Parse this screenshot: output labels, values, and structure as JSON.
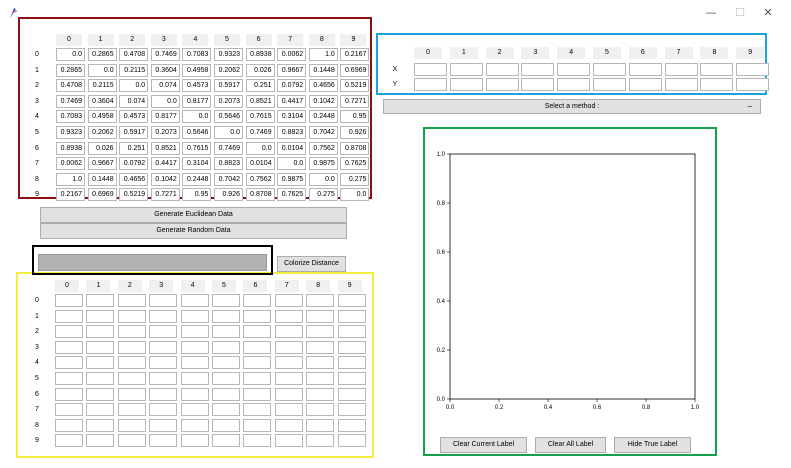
{
  "window": {
    "minimize_glyph": "—",
    "maximize_glyph": "☐",
    "close_glyph": "✕",
    "icon": "feather-icon"
  },
  "colors": {
    "distance_frame": "#8b0f0f",
    "coordinate_frame": "#19a4dc",
    "progress_frame": "#000000",
    "label_frame": "#f0ee3c",
    "plot_frame": "#13a14a",
    "progress_fill": "#b2b2b2"
  },
  "distance_matrix": {
    "columns": [
      "0",
      "1",
      "2",
      "3",
      "4",
      "5",
      "6",
      "7",
      "8",
      "9"
    ],
    "rows": [
      {
        "label": "0",
        "values": [
          "0.0",
          "0.2865",
          "0.4708",
          "0.7469",
          "0.7083",
          "0.9323",
          "0.8938",
          "0.0062",
          "1.0",
          "0.2167"
        ]
      },
      {
        "label": "1",
        "values": [
          "0.2865",
          "0.0",
          "0.2115",
          "0.3604",
          "0.4958",
          "0.2062",
          "0.026",
          "0.9667",
          "0.1448",
          "0.6969"
        ]
      },
      {
        "label": "2",
        "values": [
          "0.4708",
          "0.2115",
          "0.0",
          "0.074",
          "0.4573",
          "0.5917",
          "0.251",
          "0.0792",
          "0.4656",
          "0.5219"
        ]
      },
      {
        "label": "3",
        "values": [
          "0.7469",
          "0.3604",
          "0.074",
          "0.0",
          "0.8177",
          "0.2073",
          "0.8521",
          "0.4417",
          "0.1042",
          "0.7271"
        ]
      },
      {
        "label": "4",
        "values": [
          "0.7083",
          "0.4958",
          "0.4573",
          "0.8177",
          "0.0",
          "0.5646",
          "0.7615",
          "0.3104",
          "0.2448",
          "0.95"
        ]
      },
      {
        "label": "5",
        "values": [
          "0.9323",
          "0.2062",
          "0.5917",
          "0.2073",
          "0.5646",
          "0.0",
          "0.7469",
          "0.8823",
          "0.7042",
          "0.926"
        ]
      },
      {
        "label": "6",
        "values": [
          "0.8938",
          "0.026",
          "0.251",
          "0.8521",
          "0.7615",
          "0.7469",
          "0.0",
          "0.0104",
          "0.7562",
          "0.8708"
        ]
      },
      {
        "label": "7",
        "values": [
          "0.0062",
          "0.9667",
          "0.0792",
          "0.4417",
          "0.3104",
          "0.8823",
          "0.0104",
          "0.0",
          "0.9875",
          "0.7625"
        ]
      },
      {
        "label": "8",
        "values": [
          "1.0",
          "0.1448",
          "0.4656",
          "0.1042",
          "0.2448",
          "0.7042",
          "0.7562",
          "0.9875",
          "0.0",
          "0.275"
        ]
      },
      {
        "label": "9",
        "values": [
          "0.2167",
          "0.6969",
          "0.5219",
          "0.7271",
          "0.95",
          "0.926",
          "0.8708",
          "0.7625",
          "0.275",
          "0.0"
        ]
      }
    ]
  },
  "coordinates": {
    "columns": [
      "0",
      "1",
      "2",
      "3",
      "4",
      "5",
      "6",
      "7",
      "8",
      "9"
    ],
    "rows": [
      {
        "label": "X",
        "values": [
          "",
          "",
          "",
          "",
          "",
          "",
          "",
          "",
          "",
          ""
        ]
      },
      {
        "label": "Y",
        "values": [
          "",
          "",
          "",
          "",
          "",
          "",
          "",
          "",
          "",
          ""
        ]
      }
    ]
  },
  "labels_matrix": {
    "columns": [
      "0",
      "1",
      "2",
      "3",
      "4",
      "5",
      "6",
      "7",
      "8",
      "9"
    ],
    "rows": [
      {
        "label": "0",
        "values": [
          "",
          "",
          "",
          "",
          "",
          "",
          "",
          "",
          "",
          ""
        ]
      },
      {
        "label": "1",
        "values": [
          "",
          "",
          "",
          "",
          "",
          "",
          "",
          "",
          "",
          ""
        ]
      },
      {
        "label": "2",
        "values": [
          "",
          "",
          "",
          "",
          "",
          "",
          "",
          "",
          "",
          ""
        ]
      },
      {
        "label": "3",
        "values": [
          "",
          "",
          "",
          "",
          "",
          "",
          "",
          "",
          "",
          ""
        ]
      },
      {
        "label": "4",
        "values": [
          "",
          "",
          "",
          "",
          "",
          "",
          "",
          "",
          "",
          ""
        ]
      },
      {
        "label": "5",
        "values": [
          "",
          "",
          "",
          "",
          "",
          "",
          "",
          "",
          "",
          ""
        ]
      },
      {
        "label": "6",
        "values": [
          "",
          "",
          "",
          "",
          "",
          "",
          "",
          "",
          "",
          ""
        ]
      },
      {
        "label": "7",
        "values": [
          "",
          "",
          "",
          "",
          "",
          "",
          "",
          "",
          "",
          ""
        ]
      },
      {
        "label": "8",
        "values": [
          "",
          "",
          "",
          "",
          "",
          "",
          "",
          "",
          "",
          ""
        ]
      },
      {
        "label": "9",
        "values": [
          "",
          "",
          "",
          "",
          "",
          "",
          "",
          "",
          "",
          ""
        ]
      }
    ]
  },
  "buttons": {
    "generate_euclidean": "Generate Euclidean Data",
    "generate_random": "Generate Random Data",
    "colorize_distance": "Colorize Distance",
    "clear_current_label": "Clear Current Label",
    "clear_all_label": "Clear All Label",
    "hide_true_label": "Hide True Label"
  },
  "method_select": {
    "label": "Select a method :",
    "arrow_glyph": "⎯"
  },
  "progress": {
    "value": 1.0
  },
  "chart_data": {
    "type": "scatter",
    "series": [],
    "xlim": [
      0.0,
      1.0
    ],
    "ylim": [
      0.0,
      1.0
    ],
    "xticks": [
      "0.0",
      "0.2",
      "0.4",
      "0.6",
      "0.8",
      "1.0"
    ],
    "yticks": [
      "0.0",
      "0.2",
      "0.4",
      "0.6",
      "0.8",
      "1.0"
    ],
    "grid": false
  }
}
